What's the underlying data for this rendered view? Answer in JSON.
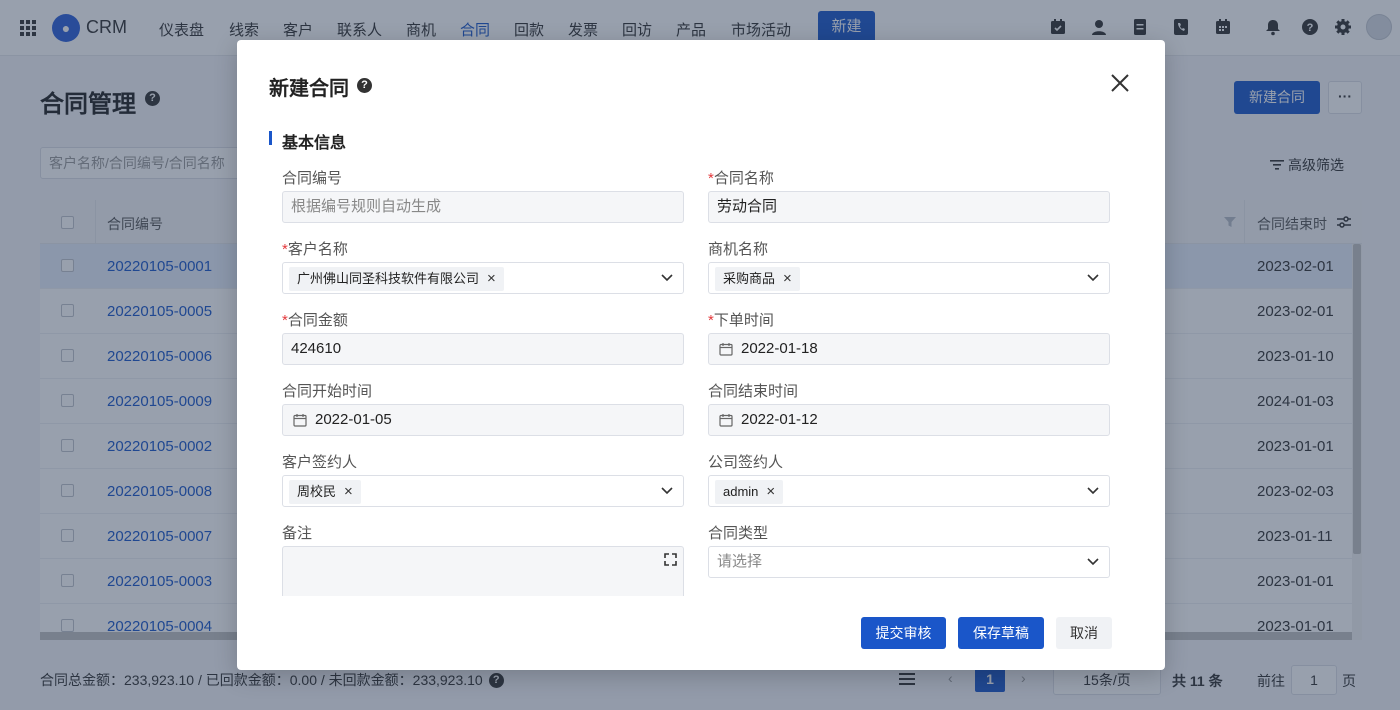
{
  "topnav": {
    "brand": "CRM",
    "items": [
      "仪表盘",
      "线索",
      "客户",
      "联系人",
      "商机",
      "合同",
      "回款",
      "发票",
      "回访",
      "产品",
      "市场活动"
    ],
    "active_item": "合同",
    "new_button": "新建",
    "right_icons": [
      "calendar-check-icon",
      "contacts-icon",
      "document-icon",
      "phone-icon",
      "schedule-icon",
      "bell-icon",
      "help-icon",
      "gear-icon",
      "user-avatar"
    ]
  },
  "page": {
    "title": "合同管理",
    "new_contract_button": "新建合同",
    "more_button": "···",
    "search_placeholder": "客户名称/合同编号/合同名称",
    "advanced_filter": "高级筛选",
    "table": {
      "columns": [
        "合同编号",
        "合同结束时"
      ],
      "rows": [
        {
          "id": "20220105-0001",
          "end": "2023-02-01",
          "selected": true
        },
        {
          "id": "20220105-0005",
          "end": "2023-02-01"
        },
        {
          "id": "20220105-0006",
          "end": "2023-01-10"
        },
        {
          "id": "20220105-0009",
          "end": "2024-01-03"
        },
        {
          "id": "20220105-0002",
          "end": "2023-01-01"
        },
        {
          "id": "20220105-0008",
          "end": "2023-02-03"
        },
        {
          "id": "20220105-0007",
          "end": "2023-01-11"
        },
        {
          "id": "20220105-0003",
          "end": "2023-01-01"
        },
        {
          "id": "20220105-0004",
          "end": "2023-01-01"
        }
      ]
    },
    "summary": "合同总金额：233,923.10 / 已回款金额：0.00 / 未回款金额：233,923.10",
    "pagination": {
      "current_page": "1",
      "page_size": "15条/页",
      "total": "共 11 条",
      "goto_label": "前往",
      "goto_value": "1",
      "page_suffix": "页"
    }
  },
  "modal": {
    "title": "新建合同",
    "section": "基本信息",
    "fields": {
      "contract_no": {
        "label": "合同编号",
        "placeholder": "根据编号规则自动生成"
      },
      "contract_name": {
        "label": "合同名称",
        "required": true,
        "value": "劳动合同"
      },
      "customer_name": {
        "label": "客户名称",
        "required": true,
        "tag": "广州佛山同圣科技软件有限公司"
      },
      "opportunity": {
        "label": "商机名称",
        "tag": "采购商品"
      },
      "amount": {
        "label": "合同金额",
        "required": true,
        "value": "424610"
      },
      "order_date": {
        "label": "下单时间",
        "required": true,
        "value": "2022-01-18"
      },
      "start_date": {
        "label": "合同开始时间",
        "value": "2022-01-05"
      },
      "end_date": {
        "label": "合同结束时间",
        "value": "2022-01-12"
      },
      "customer_signer": {
        "label": "客户签约人",
        "tag": "周校民"
      },
      "company_signer": {
        "label": "公司签约人",
        "tag": "admin"
      },
      "remark": {
        "label": "备注"
      },
      "contract_type": {
        "label": "合同类型",
        "placeholder": "请选择"
      }
    },
    "buttons": {
      "submit": "提交审核",
      "save_draft": "保存草稿",
      "cancel": "取消"
    }
  }
}
